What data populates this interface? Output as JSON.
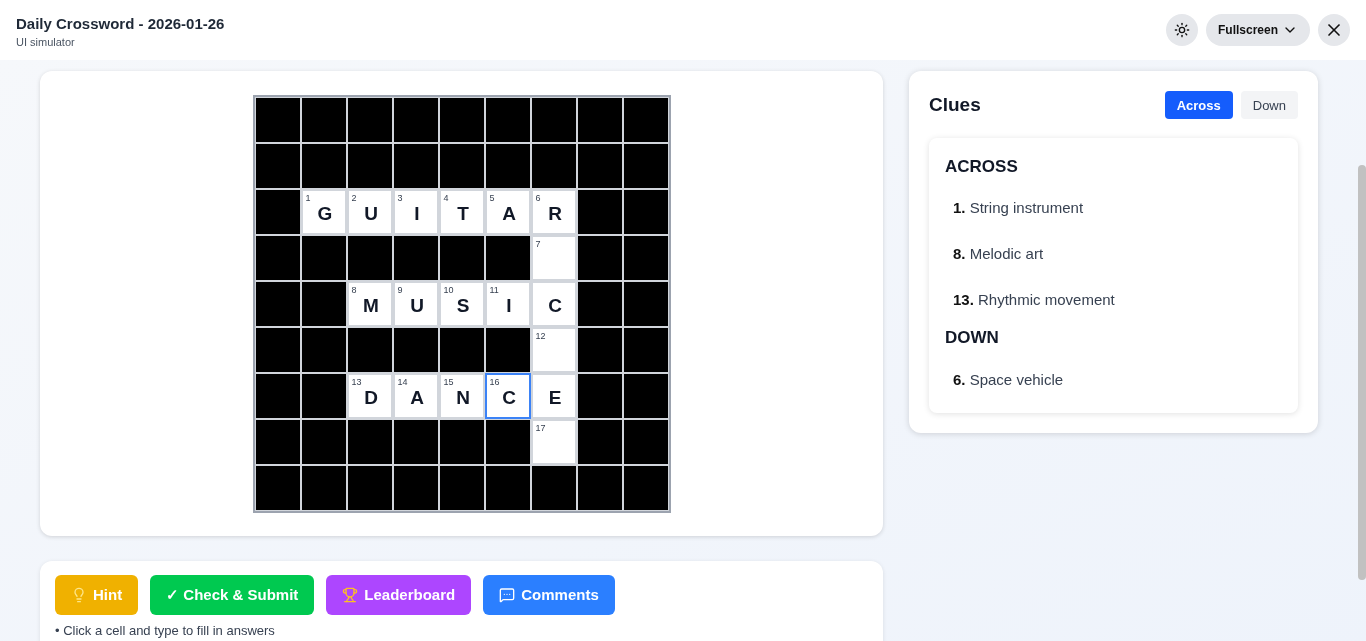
{
  "header": {
    "title": "Daily Crossword - 2026-01-26",
    "subtitle": "UI simulator",
    "view_mode": "Fullscreen"
  },
  "grid": [
    [
      {
        "kind": "block"
      },
      {
        "kind": "block"
      },
      {
        "kind": "block"
      },
      {
        "kind": "block"
      },
      {
        "kind": "block"
      },
      {
        "kind": "block"
      },
      {
        "kind": "block"
      },
      {
        "kind": "block"
      },
      {
        "kind": "block"
      }
    ],
    [
      {
        "kind": "block"
      },
      {
        "kind": "block"
      },
      {
        "kind": "block"
      },
      {
        "kind": "block"
      },
      {
        "kind": "block"
      },
      {
        "kind": "block"
      },
      {
        "kind": "block"
      },
      {
        "kind": "block"
      },
      {
        "kind": "block"
      }
    ],
    [
      {
        "kind": "block"
      },
      {
        "kind": "cell",
        "number": "1",
        "letter": "G",
        "selected": false
      },
      {
        "kind": "cell",
        "number": "2",
        "letter": "U",
        "selected": false
      },
      {
        "kind": "cell",
        "number": "3",
        "letter": "I",
        "selected": false
      },
      {
        "kind": "cell",
        "number": "4",
        "letter": "T",
        "selected": false
      },
      {
        "kind": "cell",
        "number": "5",
        "letter": "A",
        "selected": false
      },
      {
        "kind": "cell",
        "number": "6",
        "letter": "R",
        "selected": false
      },
      {
        "kind": "block"
      },
      {
        "kind": "block"
      }
    ],
    [
      {
        "kind": "block"
      },
      {
        "kind": "block"
      },
      {
        "kind": "block"
      },
      {
        "kind": "block"
      },
      {
        "kind": "block"
      },
      {
        "kind": "block"
      },
      {
        "kind": "cell",
        "number": "7",
        "selected": false
      },
      {
        "kind": "block"
      },
      {
        "kind": "block"
      }
    ],
    [
      {
        "kind": "block"
      },
      {
        "kind": "block"
      },
      {
        "kind": "cell",
        "number": "8",
        "letter": "M",
        "selected": false
      },
      {
        "kind": "cell",
        "number": "9",
        "letter": "U",
        "selected": false
      },
      {
        "kind": "cell",
        "number": "10",
        "letter": "S",
        "selected": false
      },
      {
        "kind": "cell",
        "number": "11",
        "letter": "I",
        "selected": false
      },
      {
        "kind": "cell",
        "letter": "C",
        "selected": false
      },
      {
        "kind": "block"
      },
      {
        "kind": "block"
      }
    ],
    [
      {
        "kind": "block"
      },
      {
        "kind": "block"
      },
      {
        "kind": "block"
      },
      {
        "kind": "block"
      },
      {
        "kind": "block"
      },
      {
        "kind": "block"
      },
      {
        "kind": "cell",
        "number": "12",
        "selected": false
      },
      {
        "kind": "block"
      },
      {
        "kind": "block"
      }
    ],
    [
      {
        "kind": "block"
      },
      {
        "kind": "block"
      },
      {
        "kind": "cell",
        "number": "13",
        "letter": "D",
        "selected": false
      },
      {
        "kind": "cell",
        "number": "14",
        "letter": "A",
        "selected": false
      },
      {
        "kind": "cell",
        "number": "15",
        "letter": "N",
        "selected": false
      },
      {
        "kind": "cell",
        "number": "16",
        "letter": "C",
        "selected": true
      },
      {
        "kind": "cell",
        "letter": "E",
        "selected": false
      },
      {
        "kind": "block"
      },
      {
        "kind": "block"
      }
    ],
    [
      {
        "kind": "block"
      },
      {
        "kind": "block"
      },
      {
        "kind": "block"
      },
      {
        "kind": "block"
      },
      {
        "kind": "block"
      },
      {
        "kind": "block"
      },
      {
        "kind": "cell",
        "number": "17",
        "selected": false
      },
      {
        "kind": "block"
      },
      {
        "kind": "block"
      }
    ],
    [
      {
        "kind": "block"
      },
      {
        "kind": "block"
      },
      {
        "kind": "block"
      },
      {
        "kind": "block"
      },
      {
        "kind": "block"
      },
      {
        "kind": "block"
      },
      {
        "kind": "block"
      },
      {
        "kind": "block"
      },
      {
        "kind": "block"
      }
    ]
  ],
  "actions": [
    {
      "kind": "hint",
      "label": "Hint"
    },
    {
      "kind": "check",
      "label": "✓ Check & Submit"
    },
    {
      "kind": "leaderboard",
      "label": "Leaderboard"
    },
    {
      "kind": "comments",
      "label": "Comments"
    }
  ],
  "instructions": [
    "• Click a cell and type to fill in answers"
  ],
  "clues": {
    "title": "Clues",
    "tabs": [
      {
        "label": "Across",
        "selected": true
      },
      {
        "label": "Down",
        "selected": false
      }
    ],
    "sections": [
      {
        "heading": "ACROSS",
        "items": [
          "**1.** String instrument",
          "**8.** Melodic art",
          "**13.** Rhythmic movement"
        ]
      },
      {
        "heading": "DOWN",
        "items": [
          "**6.** Space vehicle"
        ]
      }
    ]
  }
}
